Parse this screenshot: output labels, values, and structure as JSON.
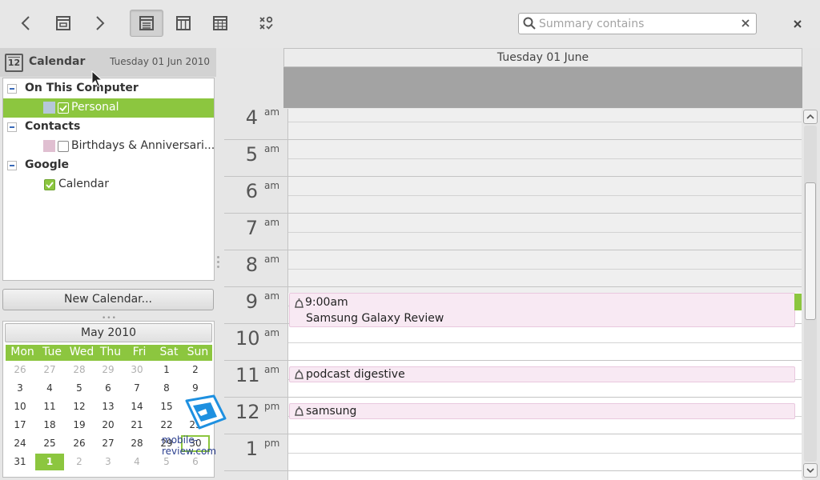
{
  "toolbar": {
    "search": {
      "placeholder": "Summary contains",
      "value": ""
    },
    "icons": [
      "back-icon",
      "today-icon",
      "forward-icon",
      "day-view-icon",
      "week-view-icon",
      "month-view-icon",
      "tasks-icon",
      "close-icon"
    ]
  },
  "sidebar": {
    "title": "Calendar",
    "date": "Tuesday 01 Jun 2010",
    "icon_number": "12",
    "groups": [
      {
        "label": "On This Computer",
        "items": [
          {
            "label": "Personal",
            "checked": true,
            "selected": true,
            "color": "#b6c7da"
          }
        ]
      },
      {
        "label": "Contacts",
        "items": [
          {
            "label": "Birthdays & Anniversari...",
            "checked": false,
            "selected": false,
            "color": "#e0bfd1"
          }
        ]
      },
      {
        "label": "Google",
        "items": [
          {
            "label": "Calendar",
            "checked": true,
            "selected": false,
            "color": ""
          }
        ]
      }
    ],
    "new_calendar_label": "New Calendar..."
  },
  "minical": {
    "month_label": "May 2010",
    "dow": [
      "Mon",
      "Tue",
      "Wed",
      "Thu",
      "Fri",
      "Sat",
      "Sun"
    ],
    "weeks": [
      [
        "26",
        "27",
        "28",
        "29",
        "30",
        "1",
        "2"
      ],
      [
        "3",
        "4",
        "5",
        "6",
        "7",
        "8",
        "9"
      ],
      [
        "10",
        "11",
        "12",
        "13",
        "14",
        "15",
        "16"
      ],
      [
        "17",
        "18",
        "19",
        "20",
        "21",
        "22",
        "23"
      ],
      [
        "24",
        "25",
        "26",
        "27",
        "28",
        "29",
        "30"
      ],
      [
        "31",
        "1",
        "2",
        "3",
        "4",
        "5",
        "6"
      ]
    ],
    "other_month_first_row": 5,
    "other_month_last_row_from": 1,
    "today": "1",
    "outlined": "30"
  },
  "dayview": {
    "header": "Tuesday 01 June",
    "hours": [
      {
        "num": "4",
        "ampm": "am"
      },
      {
        "num": "5",
        "ampm": "am"
      },
      {
        "num": "6",
        "ampm": "am"
      },
      {
        "num": "7",
        "ampm": "am"
      },
      {
        "num": "8",
        "ampm": "am"
      },
      {
        "num": "9",
        "ampm": "am"
      },
      {
        "num": "10",
        "ampm": "am"
      },
      {
        "num": "11",
        "ampm": "am"
      },
      {
        "num": "12",
        "ampm": "pm"
      },
      {
        "num": "1",
        "ampm": "pm"
      }
    ],
    "events": [
      {
        "time": "9:00am",
        "title": "Samsung Galaxy Review"
      },
      {
        "time": "",
        "title": "podcast digestive"
      },
      {
        "time": "",
        "title": "samsung"
      }
    ]
  },
  "watermark": {
    "text": "mobile-review.com"
  },
  "colors": {
    "accent": "#8cc63f",
    "event_bg": "#f8e9f3",
    "allday_bg": "#a3a3a3"
  }
}
